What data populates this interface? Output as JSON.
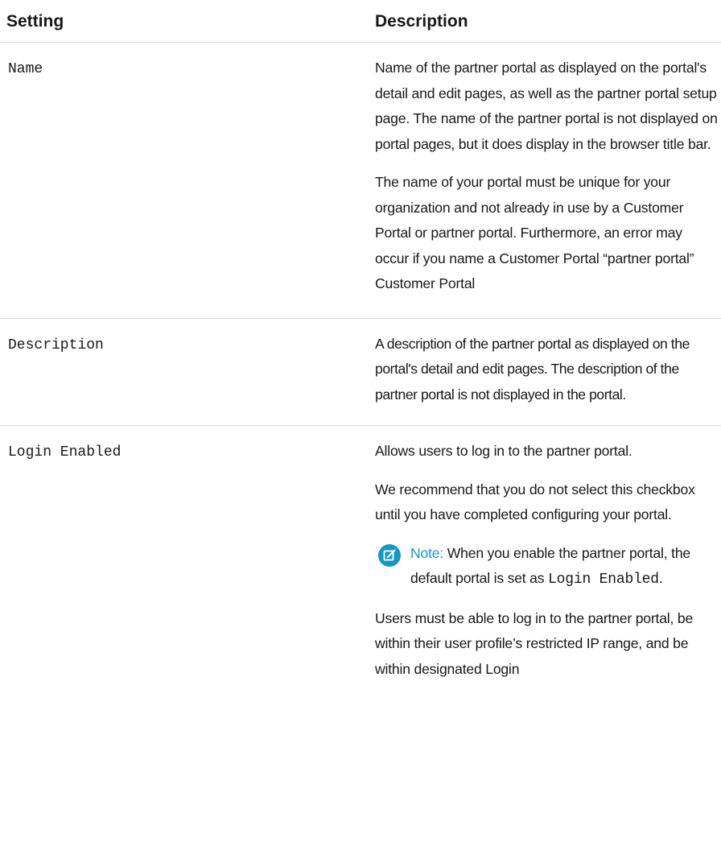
{
  "table": {
    "headers": {
      "setting": "Setting",
      "description": "Description"
    },
    "rows": [
      {
        "setting": "Name",
        "paragraphs": [
          "Name of the partner portal as displayed on the portal's detail and edit pages, as well as the partner portal setup page. The name of the partner portal is not displayed on portal pages, but it does display in the browser title bar.",
          "The name of your portal must be unique for your organization and not already in use by a Customer Portal or partner portal. Furthermore, an error may occur if you name a Customer Portal “partner portal” Customer Portal"
        ]
      },
      {
        "setting": "Description",
        "paragraphs": [
          "A description of the partner portal as displayed on the portal's detail and edit pages. The description of the partner portal is not displayed in the portal."
        ]
      },
      {
        "setting": "Login Enabled",
        "paragraphs": [
          "Allows users to log in to the partner portal.",
          "We recommend that you do not select this checkbox until you have completed configuring your portal."
        ],
        "note": {
          "icon": "edit-note-icon",
          "label": "Note:",
          "text": " When you enable the partner portal, the default portal is set as",
          "code": "Login Enabled",
          "end": "."
        },
        "after_note": "Users must be able to log in to the partner portal, be within their user profile’s restricted IP range, and be within designated Login"
      }
    ]
  },
  "colors": {
    "note_accent": "#1798c1",
    "divider": "#d8d8d8"
  }
}
